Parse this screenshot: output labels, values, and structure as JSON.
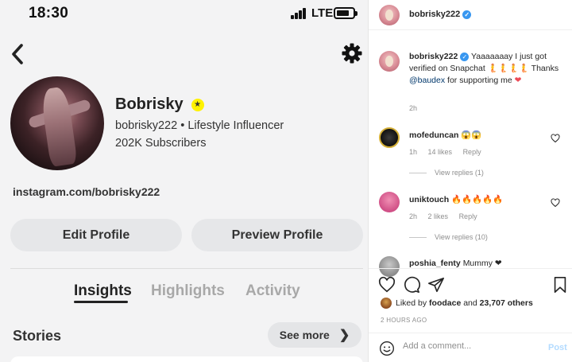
{
  "status_bar": {
    "time": "18:30",
    "network": "LTE"
  },
  "snap_profile": {
    "display_name": "Bobrisky",
    "handle_line": "bobrisky222 • Lifestyle Influencer",
    "subscribers": "202K Subscribers",
    "link": "instagram.com/bobrisky222",
    "edit_button": "Edit Profile",
    "preview_button": "Preview Profile",
    "tabs": [
      "Insights",
      "Highlights",
      "Activity"
    ],
    "stories_title": "Stories",
    "see_more": "See more",
    "colors": {
      "badge": "#fff200",
      "background": "#f3f3f4"
    }
  },
  "instagram_post": {
    "header_username": "bobrisky222",
    "caption": {
      "username": "bobrisky222",
      "text": "Yaaaaaaay I just got verified on Snapchat 🧜🧜🧜🧜 Thanks",
      "mention": "@baudex",
      "text_after": "for supporting me",
      "heart": "❤",
      "time": "2h"
    },
    "comments": [
      {
        "username": "mofeduncan",
        "text": "😱😱",
        "time": "1h",
        "likes": "14 likes",
        "reply": "Reply",
        "view_replies": "View replies (1)"
      },
      {
        "username": "uniktouch",
        "text": "🔥🔥🔥🔥🔥",
        "time": "2h",
        "likes": "2 likes",
        "reply": "Reply",
        "view_replies": "View replies (10)"
      },
      {
        "username": "poshia_fenty",
        "text": "Mummy ❤"
      }
    ],
    "likes": {
      "prefix": "Liked by",
      "user": "foodace",
      "middle": "and",
      "count": "23,707 others"
    },
    "post_time": "2 HOURS AGO",
    "comment_placeholder": "Add a comment...",
    "post_button": "Post",
    "colors": {
      "verified": "#3897f0",
      "link": "#00376b"
    }
  }
}
